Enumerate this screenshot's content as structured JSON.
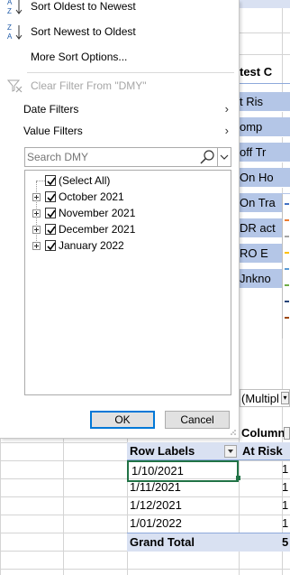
{
  "menu": {
    "sort_asc": "Sort Oldest to Newest",
    "sort_desc": "Sort Newest to Oldest",
    "more_sort": "More Sort Options...",
    "clear_filter": "Clear Filter From \"DMY\"",
    "date_filters": "Date Filters",
    "value_filters": "Value Filters",
    "search_placeholder": "Search DMY",
    "items": [
      {
        "label": "(Select All)",
        "checked": true
      },
      {
        "label": "October 2021",
        "checked": true
      },
      {
        "label": "November 2021",
        "checked": true
      },
      {
        "label": "December 2021",
        "checked": true
      },
      {
        "label": "January 2022",
        "checked": true
      }
    ],
    "ok": "OK",
    "cancel": "Cancel"
  },
  "sheet": {
    "partial_header": "test C",
    "partial_cells": [
      "t Ris",
      "omp",
      "off Tr",
      "On Ho",
      "On Tra",
      "DR act",
      "RO E",
      "Jnkno"
    ],
    "multiple_label": "(Multipl",
    "column_label": "Column",
    "pivot": {
      "row_labels_header": "Row Labels",
      "first_col_header": "At Risk",
      "rows": [
        {
          "label": "1/10/2021",
          "value": "1"
        },
        {
          "label": "1/11/2021",
          "value": "1"
        },
        {
          "label": "1/12/2021",
          "value": "1"
        },
        {
          "label": "1/01/2022",
          "value": "1"
        }
      ],
      "grand_total_label": "Grand Total",
      "grand_total_value": "5"
    }
  }
}
